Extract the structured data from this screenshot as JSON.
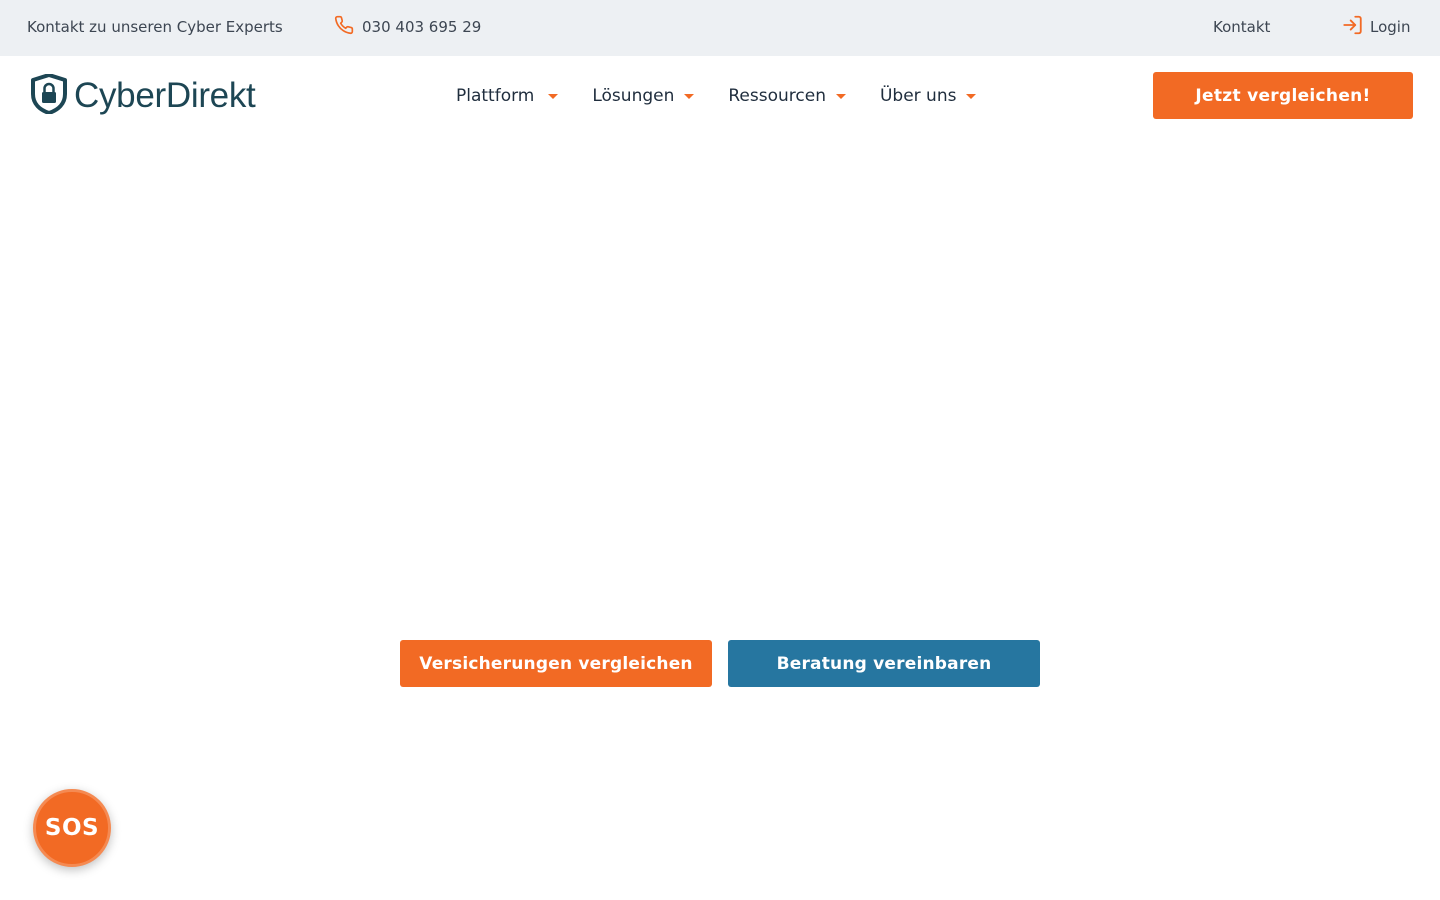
{
  "topbar": {
    "contact_text": "Kontakt zu unseren Cyber Experts",
    "phone": "030 403 695 29",
    "phone_icon": "phone-icon",
    "kontakt_link": "Kontakt",
    "login_label": "Login",
    "login_icon": "login-icon"
  },
  "header": {
    "logo_text": "CyberDirekt",
    "logo_icon": "shield-lock-icon",
    "nav": [
      {
        "label": "Plattform"
      },
      {
        "label": "Lösungen"
      },
      {
        "label": "Ressourcen"
      },
      {
        "label": "Über uns"
      }
    ],
    "cta_label": "Jetzt vergleichen!"
  },
  "hero": {
    "compare_button": "Versicherungen vergleichen",
    "consult_button": "Beratung vereinbaren"
  },
  "sos_button": "SOS",
  "colors": {
    "accent_orange": "#f26a24",
    "accent_blue": "#2676a0",
    "brand_dark": "#1d4654",
    "topbar_bg": "#edf0f3"
  }
}
